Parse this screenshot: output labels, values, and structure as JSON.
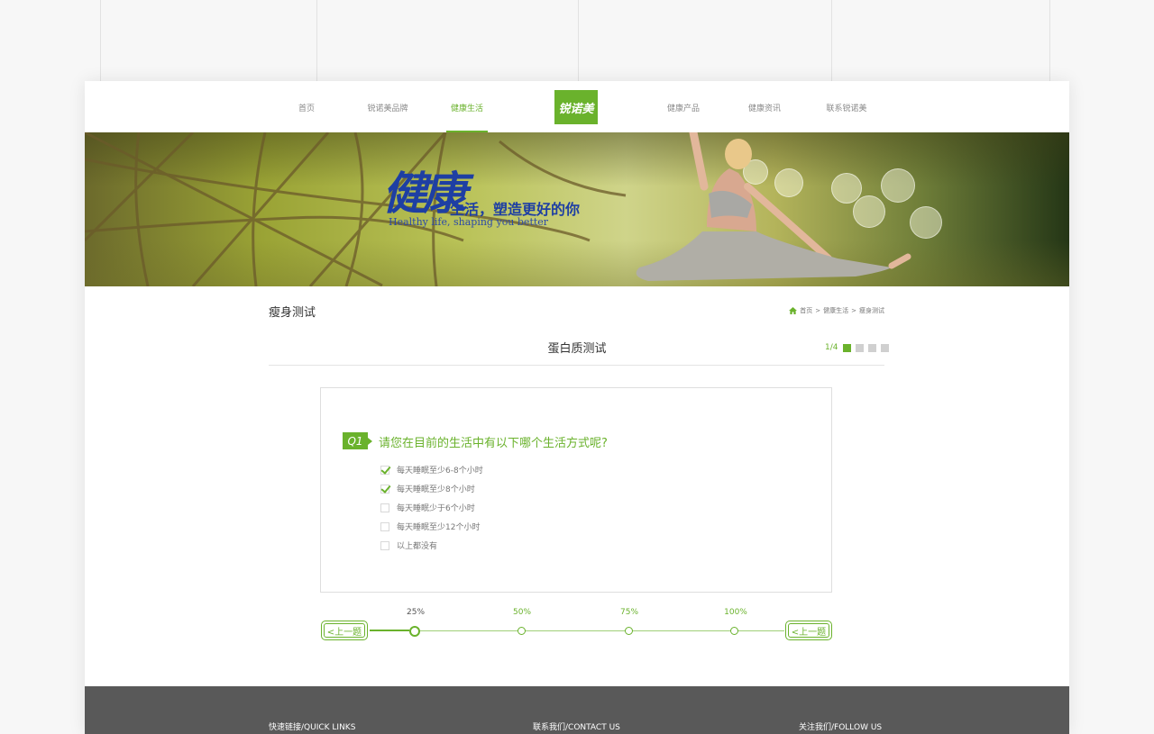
{
  "nav": {
    "items_left": [
      "首页",
      "锐诺美品牌",
      "健康生活"
    ],
    "items_right": [
      "健康产品",
      "健康资讯",
      "联系锐诺美"
    ],
    "logo_text": "锐诺美",
    "active": "健康生活"
  },
  "banner": {
    "brush_text": "健康",
    "slogan_cn": "生活，塑造更好的你",
    "slogan_en": "Healthy life, shaping you better"
  },
  "page_header": {
    "title": "瘦身测试",
    "breadcrumb": [
      "首页",
      "健康生活",
      "瘦身测试"
    ],
    "breadcrumb_sep": ">"
  },
  "quiz": {
    "title": "蛋白质测试",
    "progress_label": "1/4",
    "current_step": 1,
    "total_steps": 4,
    "question_tag": "Q1",
    "question": "请您在目前的生活中有以下哪个生活方式呢?",
    "options": [
      {
        "label": "每天睡眠至少6-8个小时",
        "checked": true
      },
      {
        "label": "每天睡眠至少8个小时",
        "checked": true
      },
      {
        "label": "每天睡眠少于6个小时",
        "checked": false
      },
      {
        "label": "每天睡眠至少12个小时",
        "checked": false
      },
      {
        "label": "以上都没有",
        "checked": false
      }
    ],
    "progress_marks": [
      "25%",
      "50%",
      "75%",
      "100%"
    ],
    "progress_fraction": 0.25,
    "prev_label": "<上一题",
    "next_label": "<上一题"
  },
  "footer": {
    "quick_links": "快速链接/QUICK  LINKS",
    "contact": "联系我们/CONTACT US",
    "follow": "关注我们/FOLLOW  US"
  },
  "colors": {
    "accent": "#6ab22c",
    "footer_bg": "#595959",
    "slogan": "#1e3fa3"
  },
  "icons": {
    "breadcrumb_home": "home-icon",
    "option_checked": "checkmark-icon"
  }
}
